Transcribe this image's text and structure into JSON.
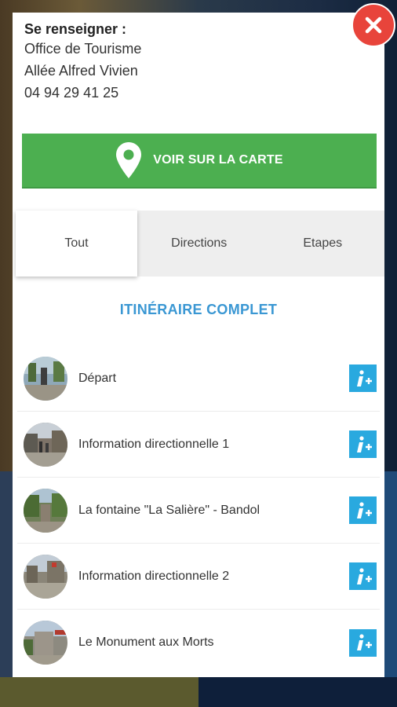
{
  "info": {
    "heading": "Se renseigner :",
    "lines": [
      "Office de Tourisme",
      "Allée Alfred Vivien",
      "04 94 29 41 25"
    ]
  },
  "map_button": {
    "label": "VOIR SUR LA CARTE"
  },
  "tabs": [
    {
      "label": "Tout",
      "active": true
    },
    {
      "label": "Directions",
      "active": false
    },
    {
      "label": "Etapes",
      "active": false
    }
  ],
  "section_title": "ITINÉRAIRE COMPLET",
  "items": [
    {
      "label": "Départ"
    },
    {
      "label": "Information directionnelle 1"
    },
    {
      "label": "La fontaine \"La Salière\" - Bandol"
    },
    {
      "label": "Information directionnelle 2"
    },
    {
      "label": "Le Monument aux Morts"
    }
  ],
  "colors": {
    "close": "#e8443b",
    "map_button": "#4caf50",
    "accent": "#3a97d3",
    "info_button": "#29a9df"
  },
  "icons": {
    "close": "close-icon",
    "map_pin": "map-pin-icon",
    "info": "info-plus-icon"
  }
}
